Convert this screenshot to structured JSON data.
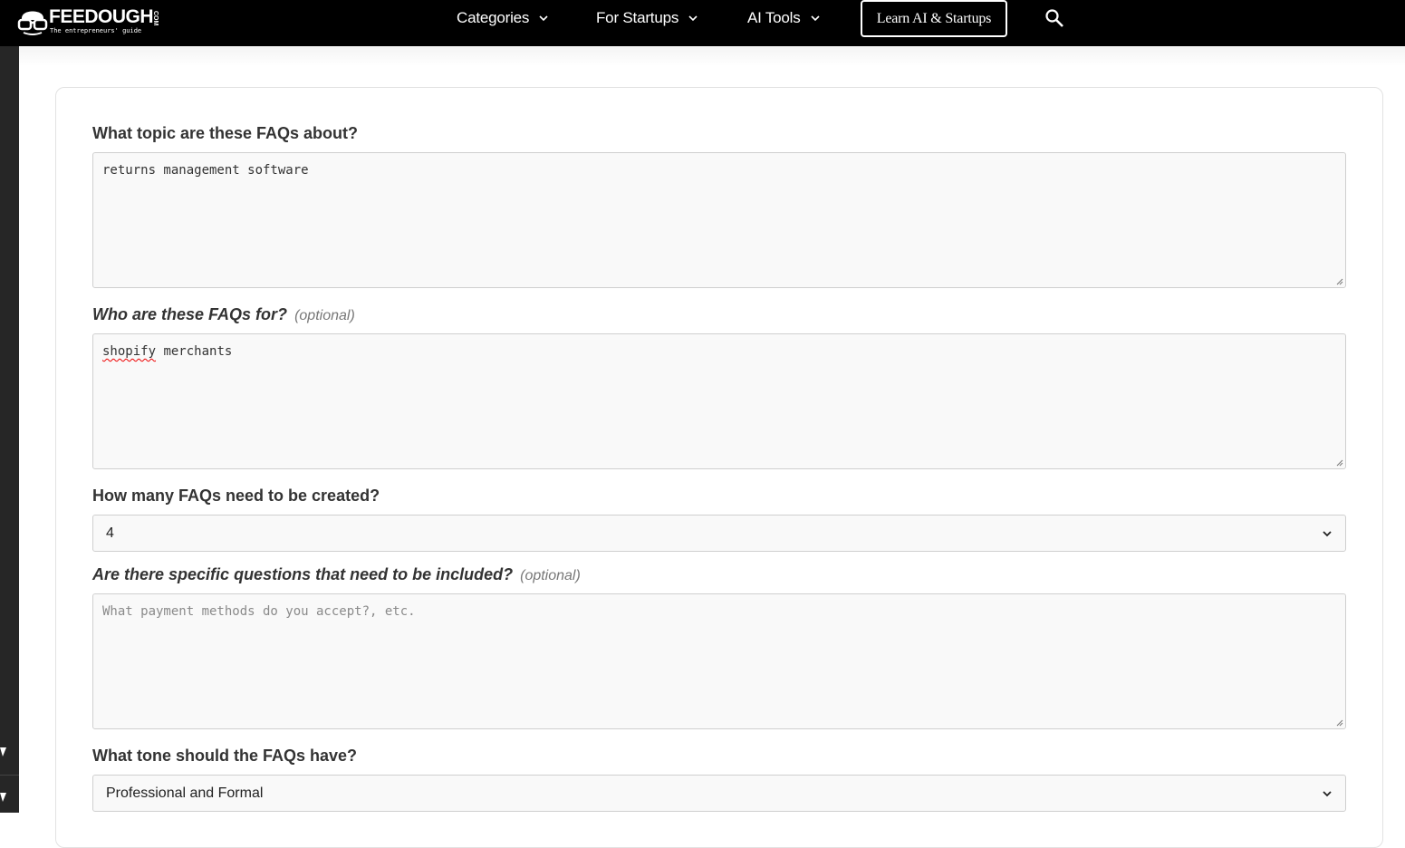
{
  "brand": {
    "name": "FEEDOUGH",
    "suffix": "COM",
    "tagline": "The entrepreneurs' guide"
  },
  "nav": {
    "items": [
      {
        "label": "Categories"
      },
      {
        "label": "For Startups"
      },
      {
        "label": "AI Tools"
      }
    ],
    "cta_label": "Learn AI & Startups"
  },
  "form": {
    "topic": {
      "label": "What topic are these FAQs about?",
      "value": "returns management software"
    },
    "audience": {
      "label": "Who are these FAQs for?",
      "optional_tag": "(optional)",
      "value_misspelled": "shopify",
      "value_rest": " merchants"
    },
    "count": {
      "label": "How many FAQs need to be created?",
      "selected": "4"
    },
    "questions": {
      "label": "Are there specific questions that need to be included?",
      "optional_tag": "(optional)",
      "placeholder": "What payment methods do you accept?, etc."
    },
    "tone": {
      "label": "What tone should the FAQs have?",
      "selected": "Professional and Formal"
    }
  },
  "colors": {
    "nav_bg": "#000000",
    "rail_bg": "#262626",
    "field_bg": "#f9f9f9",
    "field_border": "#cfcfcf",
    "label_text": "#333333"
  }
}
